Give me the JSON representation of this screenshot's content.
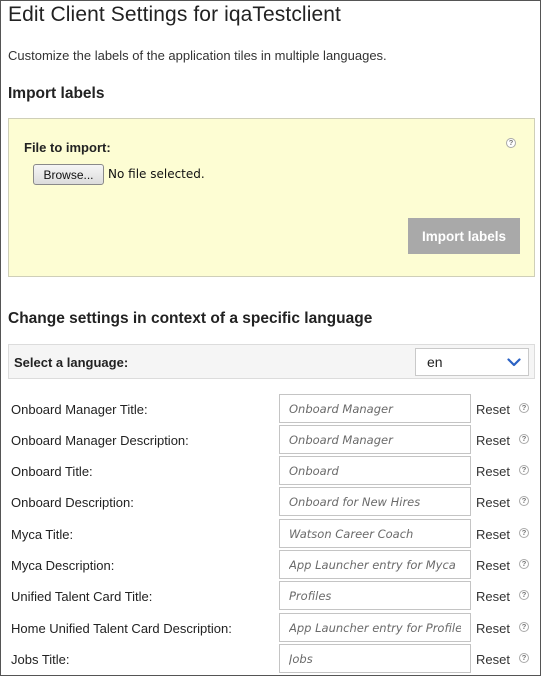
{
  "page": {
    "title": "Edit Client Settings for iqaTestclient",
    "intro": "Customize the labels of the application tiles in multiple languages."
  },
  "import": {
    "heading": "Import labels",
    "file_label": "File to import:",
    "browse_label": "Browse...",
    "no_file_text": "No file selected.",
    "help_glyph": "?",
    "import_button_label": "Import labels"
  },
  "language": {
    "heading": "Change settings in context of a specific language",
    "select_label": "Select a language:",
    "selected_value": "en"
  },
  "fields": [
    {
      "label": "Onboard Manager Title:",
      "placeholder": "Onboard Manager",
      "reset": "Reset",
      "help": "?"
    },
    {
      "label": "Onboard Manager Description:",
      "placeholder": "Onboard Manager",
      "reset": "Reset",
      "help": "?"
    },
    {
      "label": "Onboard Title:",
      "placeholder": "Onboard",
      "reset": "Reset",
      "help": "?"
    },
    {
      "label": "Onboard Description:",
      "placeholder": "Onboard for New Hires",
      "reset": "Reset",
      "help": "?"
    },
    {
      "label": "Myca Title:",
      "placeholder": "Watson Career Coach",
      "reset": "Reset",
      "help": "?"
    },
    {
      "label": "Myca Description:",
      "placeholder": "App Launcher entry for Myca",
      "reset": "Reset",
      "help": "?"
    },
    {
      "label": "Unified Talent Card Title:",
      "placeholder": "Profiles",
      "reset": "Reset",
      "help": "?"
    },
    {
      "label": "Home Unified Talent Card Description:",
      "placeholder": "App Launcher entry for Profiles",
      "reset": "Reset",
      "help": "?"
    },
    {
      "label": "Jobs Title:",
      "placeholder": "Jobs",
      "reset": "Reset",
      "help": "?"
    }
  ],
  "colors": {
    "panel_bg": "#fdfdd3",
    "import_button_bg": "#a9a9a9",
    "select_chevron": "#2b62c4"
  },
  "icons": {
    "help": "help-icon",
    "dropdown": "chevron-down-icon"
  }
}
